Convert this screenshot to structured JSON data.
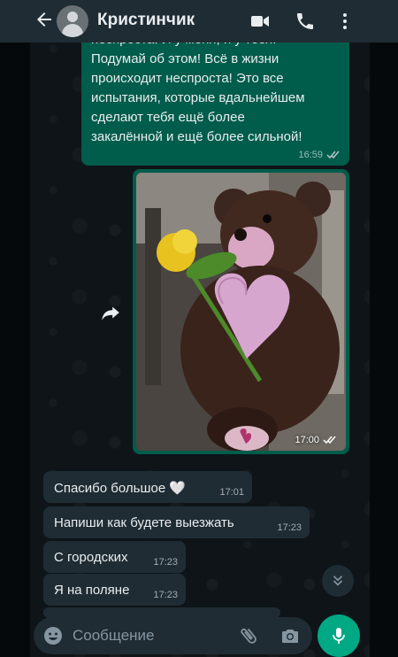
{
  "header": {
    "title": "Кристинчик",
    "back_icon": "arrow-left-icon",
    "avatar_icon": "default-avatar-icon",
    "actions": [
      "video-call-icon",
      "phone-icon",
      "more-vert-icon"
    ]
  },
  "messages": {
    "outgoing_text": {
      "text": "неспроста! И у меня, и у тебя!\nПодумай об этом! Всё в жизни\nпроисходит неспроста! Это все\nиспытания, которые вдальнейшем\nсделают тебя ещё более\nзакалённой и ещё более сильной!",
      "time": "16:59",
      "status_icon": "double-check-icon"
    },
    "outgoing_image": {
      "time": "17:00",
      "status_icon": "double-check-icon",
      "forward_icon": "forward-icon"
    },
    "incoming": [
      {
        "text": "Спасибо большое 🤍",
        "time": "17:01"
      },
      {
        "text": "Напиши как будете выезжать",
        "time": "17:23"
      },
      {
        "text": "С городских",
        "time": "17:23"
      },
      {
        "text": "Я на поляне",
        "time": "17:23"
      }
    ]
  },
  "input": {
    "placeholder": "Сообщение",
    "icons": [
      "emoji-icon",
      "paperclip-icon",
      "camera-icon",
      "mic-icon"
    ]
  },
  "colors": {
    "header_bg": "#1f2c34",
    "outgoing_bubble": "#005c4b",
    "incoming_bubble": "#1f2c34",
    "send_button": "#00a884"
  }
}
